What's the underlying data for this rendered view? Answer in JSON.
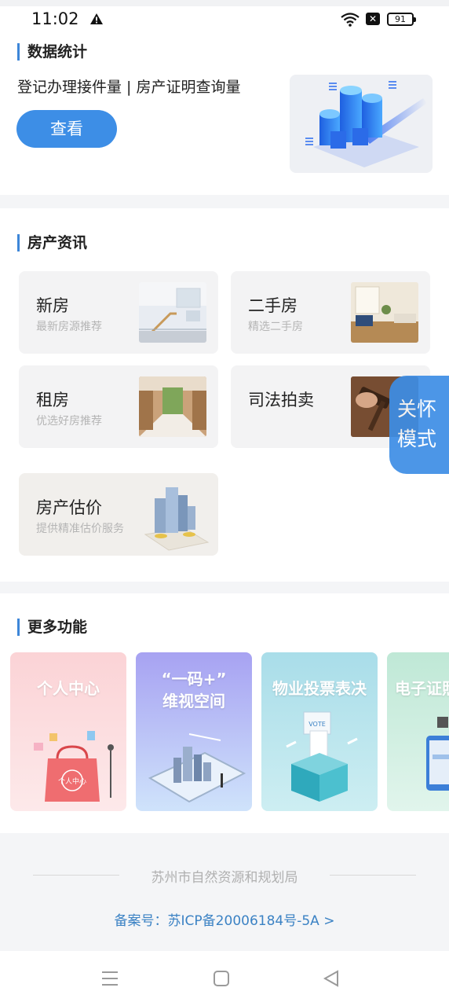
{
  "status_bar": {
    "time": "11:02",
    "battery": "91"
  },
  "stats": {
    "title": "数据统计",
    "subtitle": "登记办理接件量 | 房产证明查询量",
    "view_label": "查看"
  },
  "news": {
    "title": "房产资讯",
    "tiles": [
      {
        "title": "新房",
        "subtitle": "最新房源推荐"
      },
      {
        "title": "二手房",
        "subtitle": "精选二手房"
      },
      {
        "title": "租房",
        "subtitle": "优选好房推荐"
      },
      {
        "title": "司法拍卖",
        "subtitle": ""
      },
      {
        "title": "房产估价",
        "subtitle": "提供精准估价服务"
      }
    ]
  },
  "care_mode": {
    "line1": "关怀",
    "line2": "模式"
  },
  "more": {
    "title": "更多功能",
    "items": [
      {
        "title": "个人中心",
        "title2": ""
      },
      {
        "title": "“一码+”",
        "title2": "维视空间"
      },
      {
        "title": "物业投票表决",
        "title2": ""
      },
      {
        "title": "电子证照",
        "title2": ""
      }
    ],
    "vote_badge": "VOTE",
    "bag_text": "个人中心"
  },
  "footer": {
    "org": "苏州市自然资源和规划局",
    "icp": "备案号：苏ICP备20006184号-5A >"
  },
  "colors": {
    "accent": "#3d8ee6",
    "title_bar": "#3d86d8",
    "link": "#3b82c4"
  }
}
